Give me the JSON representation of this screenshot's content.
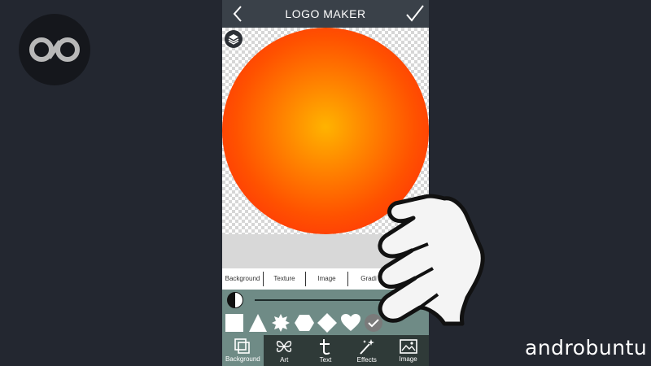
{
  "header": {
    "title": "LOGO MAKER"
  },
  "canvas": {
    "colors": {
      "center": "#ffb300",
      "edge": "#ff1f0f"
    }
  },
  "subtabs": [
    "Background",
    "Texture",
    "Image",
    "Gradi"
  ],
  "shapes": [
    "square",
    "triangle",
    "star8",
    "hexagon",
    "diamond",
    "heart",
    "selected-check"
  ],
  "bottom_nav": [
    {
      "label": "Background",
      "icon": "background-icon",
      "active": true
    },
    {
      "label": "Art",
      "icon": "art-icon",
      "active": false
    },
    {
      "label": "Text",
      "icon": "text-icon",
      "active": false
    },
    {
      "label": "Effects",
      "icon": "effects-icon",
      "active": false
    },
    {
      "label": "Image",
      "icon": "image-icon",
      "active": false
    }
  ],
  "watermark": {
    "brand": "androbuntu"
  }
}
